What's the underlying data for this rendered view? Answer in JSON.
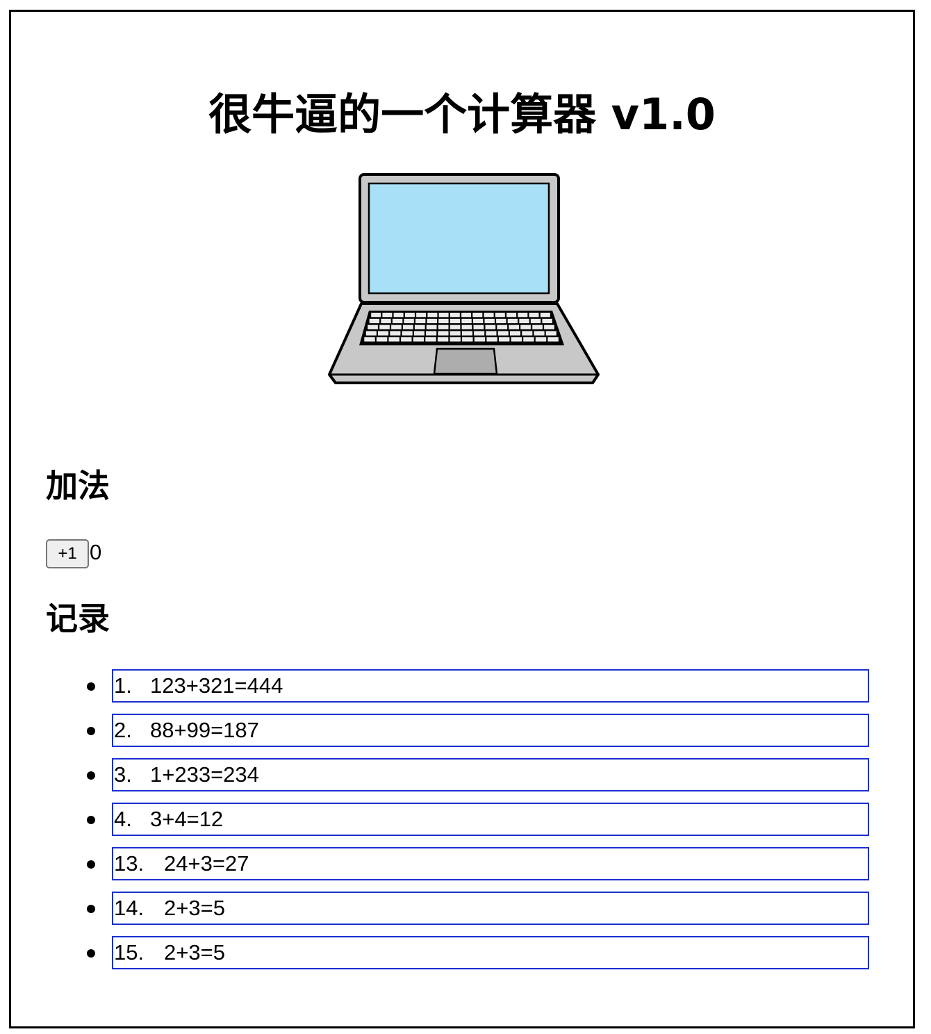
{
  "page": {
    "title": "很牛逼的一个计算器 v1.0",
    "hero_icon": "laptop-icon"
  },
  "addition": {
    "heading": "加法",
    "increment_label": "+1",
    "count": "0"
  },
  "records": {
    "heading": "记录",
    "items": [
      {
        "index": "1.",
        "expr": "123+321=444"
      },
      {
        "index": "2.",
        "expr": "88+99=187"
      },
      {
        "index": "3.",
        "expr": "1+233=234"
      },
      {
        "index": "4.",
        "expr": "3+4=12"
      },
      {
        "index": "13.",
        "expr": "24+3=27"
      },
      {
        "index": "14.",
        "expr": "2+3=5"
      },
      {
        "index": "15.",
        "expr": "2+3=5"
      }
    ]
  },
  "colors": {
    "record_border": "#1a2fd0",
    "screen": "#a8e0f8",
    "laptop_body": "#c8c8c8"
  }
}
